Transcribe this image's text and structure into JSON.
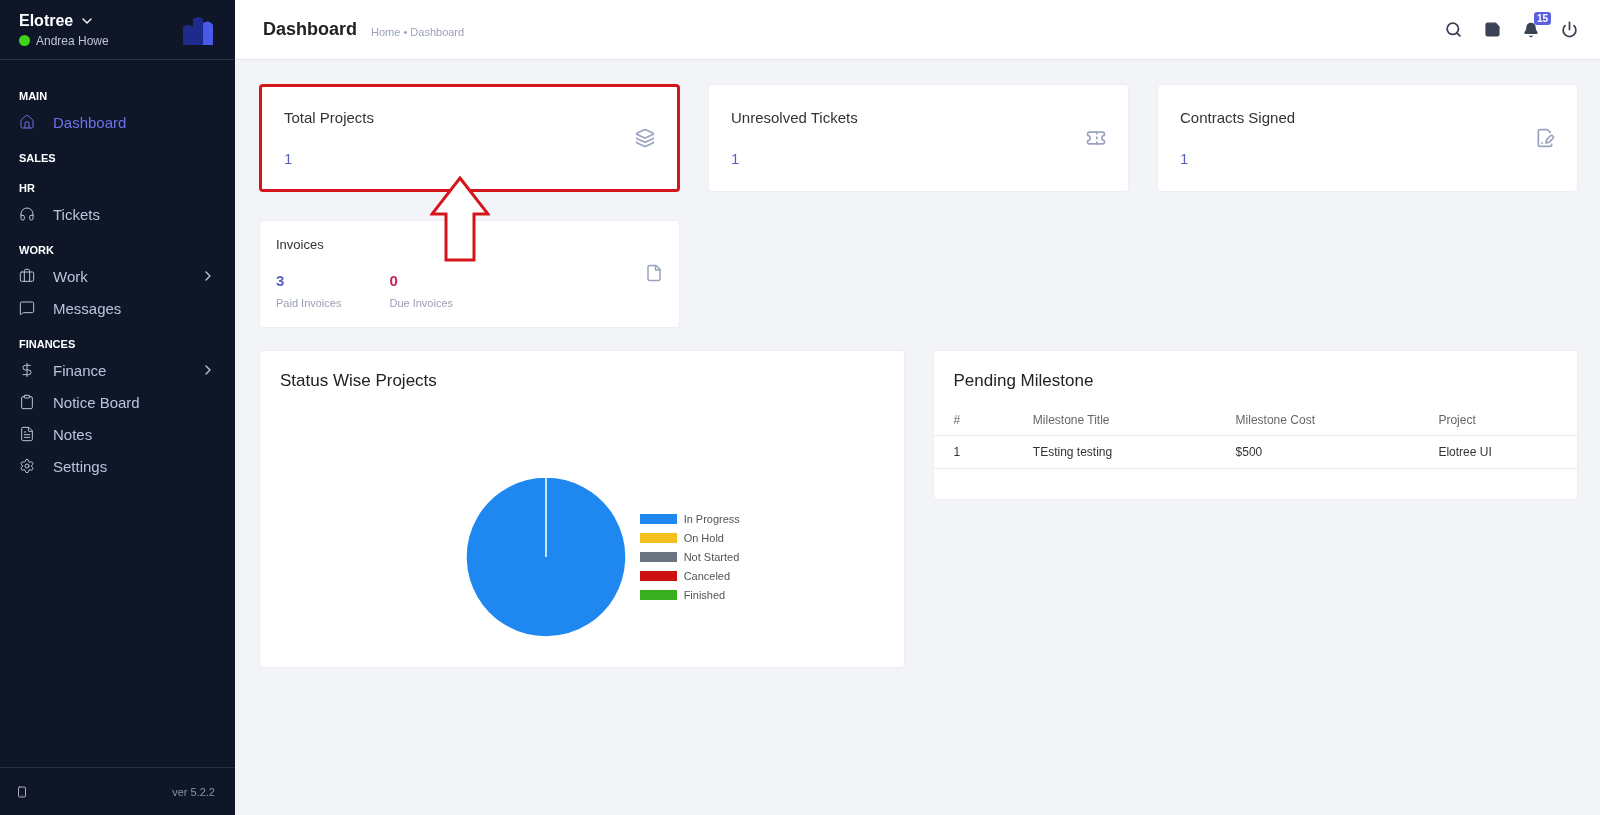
{
  "sidebar": {
    "company": "Elotree",
    "user": "Andrea Howe",
    "online": true,
    "sections": [
      {
        "heading": "MAIN",
        "items": [
          {
            "label": "Dashboard",
            "selected": true,
            "has_children": false
          }
        ]
      },
      {
        "heading": "SALES"
      },
      {
        "heading": "HR",
        "items": [
          {
            "label": "Tickets",
            "selected": false,
            "has_children": false
          }
        ]
      },
      {
        "heading": "WORK",
        "items": [
          {
            "label": "Work",
            "selected": false,
            "has_children": true
          },
          {
            "label": "Messages",
            "selected": false,
            "has_children": false
          }
        ]
      },
      {
        "heading": "FINANCES",
        "items": [
          {
            "label": "Finance",
            "selected": false,
            "has_children": true
          },
          {
            "label": "Notice Board",
            "selected": false,
            "has_children": false
          },
          {
            "label": "Notes",
            "selected": false,
            "has_children": false
          },
          {
            "label": "Settings",
            "selected": false,
            "has_children": false
          }
        ]
      }
    ],
    "version": "ver 5.2.2"
  },
  "header": {
    "title": "Dashboard",
    "breadcrumb": "Home • Dashboard",
    "notification_count": "15"
  },
  "stat_cards": [
    {
      "title": "Total Projects",
      "value": "1",
      "highlighted": true
    },
    {
      "title": "Unresolved Tickets",
      "value": "1",
      "highlighted": false
    },
    {
      "title": "Contracts Signed",
      "value": "1",
      "highlighted": false
    }
  ],
  "invoices": {
    "title": "Invoices",
    "items": [
      {
        "value": "3",
        "label": "Paid Invoices",
        "color": "#5a5fc4"
      },
      {
        "value": "0",
        "label": "Due Invoices",
        "color": "#c4245a"
      }
    ]
  },
  "status_projects": {
    "title": "Status Wise Projects",
    "legend": [
      {
        "label": "In Progress",
        "color": "#1e88f0"
      },
      {
        "label": "On Hold",
        "color": "#f4c020"
      },
      {
        "label": "Not Started",
        "color": "#6b7582"
      },
      {
        "label": "Canceled",
        "color": "#cc1010"
      },
      {
        "label": "Finished",
        "color": "#38b020"
      }
    ],
    "chart_data": {
      "type": "pie",
      "values": [
        1,
        0,
        0,
        0,
        0
      ]
    }
  },
  "pending_milestone": {
    "title": "Pending Milestone",
    "columns": [
      "#",
      "Milestone Title",
      "Milestone Cost",
      "Project"
    ],
    "rows": [
      [
        "1",
        "TEsting testing",
        "$500",
        "Elotree UI"
      ]
    ]
  }
}
